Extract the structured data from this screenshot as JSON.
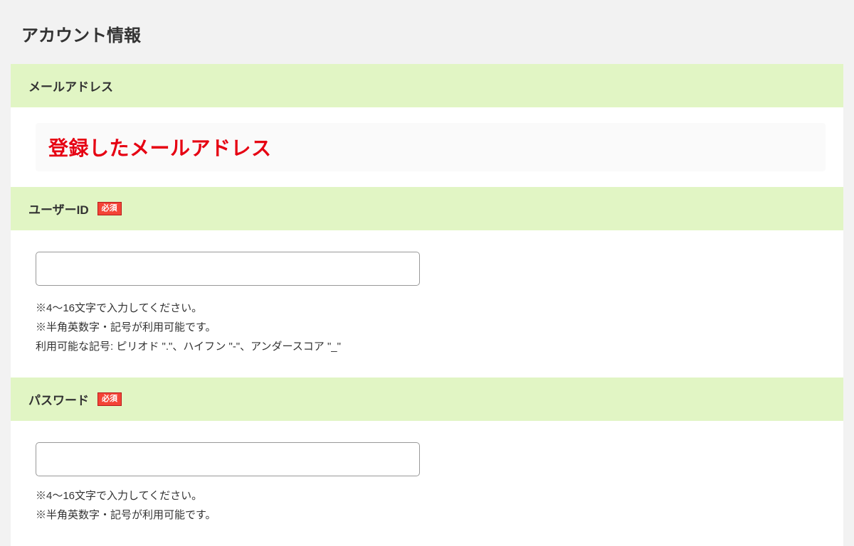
{
  "section": {
    "title": "アカウント情報"
  },
  "email": {
    "label": "メールアドレス",
    "value": "登録したメールアドレス"
  },
  "user_id": {
    "label": "ユーザーID",
    "required": "必須",
    "help1": "※4～16文字で入力してください。",
    "help2": "※半角英数字・記号が利用可能です。",
    "help3": " 利用可能な記号: ピリオド \".\"、ハイフン \"-\"、アンダースコア \"_\""
  },
  "password": {
    "label": "パスワード",
    "required": "必須",
    "help1": "※4～16文字で入力してください。",
    "help2": "※半角英数字・記号が利用可能です。"
  }
}
